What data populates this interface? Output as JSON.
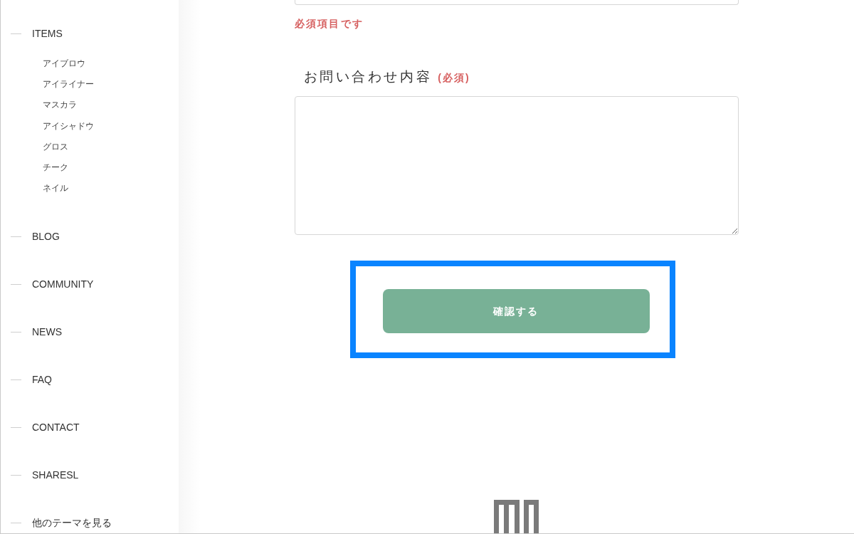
{
  "sidebar": {
    "items": [
      {
        "label": "ITEMS",
        "children": [
          {
            "label": "アイブロウ"
          },
          {
            "label": "アイライナー"
          },
          {
            "label": "マスカラ"
          },
          {
            "label": "アイシャドウ"
          },
          {
            "label": "グロス"
          },
          {
            "label": "チーク"
          },
          {
            "label": "ネイル"
          }
        ]
      },
      {
        "label": "BLOG"
      },
      {
        "label": "COMMUNITY"
      },
      {
        "label": "NEWS"
      },
      {
        "label": "FAQ"
      },
      {
        "label": "CONTACT"
      },
      {
        "label": "SHARESL"
      },
      {
        "label": "他のテーマを見る"
      }
    ]
  },
  "form": {
    "fields": [
      {
        "kind": "text",
        "error": "必須項目です"
      },
      {
        "kind": "textarea",
        "label": "お問い合わせ内容",
        "required_mark": "(必須)"
      }
    ],
    "submit": {
      "label": "確認する",
      "highlighted": true
    }
  }
}
